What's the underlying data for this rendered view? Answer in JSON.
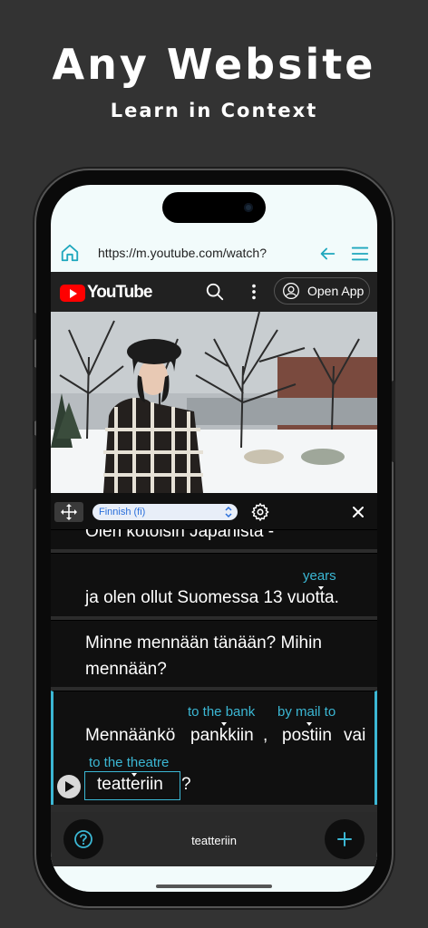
{
  "promo": {
    "headline": "Any Website",
    "subheadline": "Learn in Context"
  },
  "browser": {
    "url": "https://m.youtube.com/watch?"
  },
  "youtube": {
    "logo_text": "YouTube",
    "open_app_label": "Open App"
  },
  "toolbar": {
    "language": "Finnish (fi)"
  },
  "subtitles": [
    {
      "text": "Olen kotoisin Japanista -"
    },
    {
      "text": "ja olen ollut Suomessa 13 vuotta.",
      "glosses": [
        {
          "word": "vuotta",
          "translation": "years"
        }
      ]
    },
    {
      "line1": "Minne mennään tänään? Mihin",
      "line2": "mennään?"
    },
    {
      "words": [
        "Mennäänkö",
        "pankkiin",
        ",",
        "postiin",
        "vai",
        "teatteriin",
        "?"
      ],
      "glosses": [
        {
          "word": "pankkiin",
          "translation": "to the bank"
        },
        {
          "word": "postiin",
          "translation": "by mail to"
        },
        {
          "word": "teatteriin",
          "translation": "to the theatre"
        }
      ],
      "selected_word": "teatteriin"
    }
  ],
  "bottom_bar": {
    "selected_word": "teatteriin"
  },
  "colors": {
    "accent": "#3bb7d4",
    "background": "#333333",
    "youtube_red": "#ff0000"
  }
}
